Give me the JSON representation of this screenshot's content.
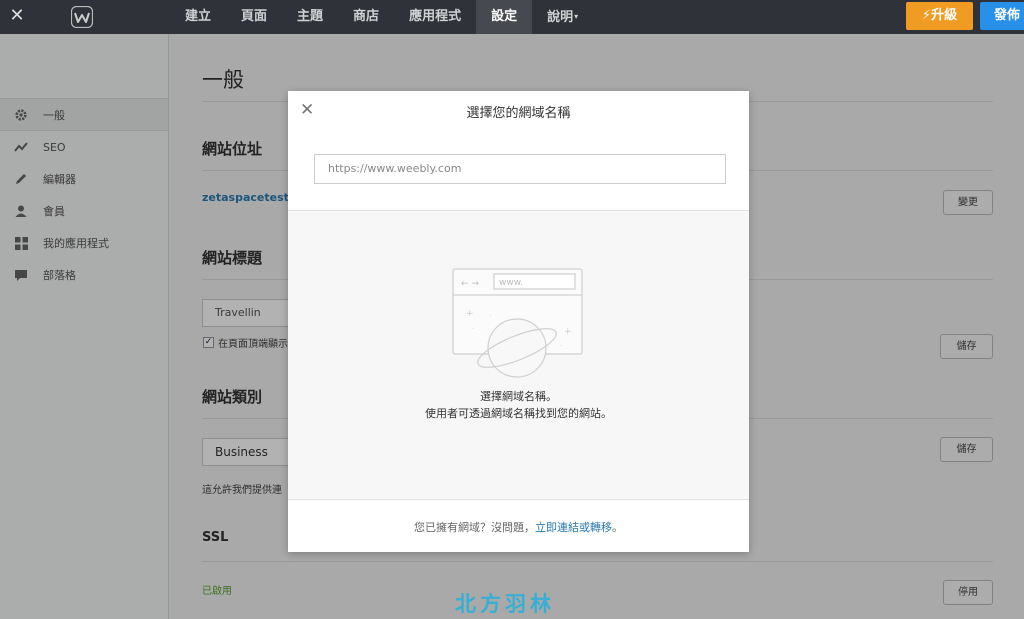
{
  "topbar": {
    "close_icon": "close-icon",
    "logo_icon": "weebly-logo-icon",
    "nav": [
      {
        "label": "建立",
        "active": false
      },
      {
        "label": "頁面",
        "active": false
      },
      {
        "label": "主題",
        "active": false
      },
      {
        "label": "商店",
        "active": false
      },
      {
        "label": "應用程式",
        "active": false
      },
      {
        "label": "設定",
        "active": true
      },
      {
        "label": "說明",
        "active": false
      }
    ],
    "upgrade_label": "升級",
    "publish_label": "發佈",
    "colors": {
      "bar": "#2f3238",
      "upgrade": "#f09b22",
      "publish": "#2990ea"
    }
  },
  "sidebar": {
    "items": [
      {
        "label": "一般",
        "icon": "gear-icon",
        "active": true
      },
      {
        "label": "SEO",
        "icon": "trend-line-icon",
        "active": false
      },
      {
        "label": "編輯器",
        "icon": "pencil-icon",
        "active": false
      },
      {
        "label": "會員",
        "icon": "user-icon",
        "active": false
      },
      {
        "label": "我的應用程式",
        "icon": "apps-grid-icon",
        "active": false
      },
      {
        "label": "部落格",
        "icon": "comment-icon",
        "active": false
      }
    ]
  },
  "main": {
    "title": "一般",
    "site_address": {
      "heading": "網站位址",
      "url": "zetaspacetest.w",
      "button": "變更"
    },
    "site_title": {
      "heading": "網站標題",
      "value": "Travellin",
      "checkbox_label": "在頁面頂端顯示",
      "checked": true,
      "button": "儲存"
    },
    "site_category": {
      "heading": "網站類別",
      "value": "Business",
      "help": "這允許我們提供連",
      "button": "儲存"
    },
    "ssl": {
      "heading": "SSL",
      "status": "已啟用",
      "button": "停用"
    }
  },
  "modal": {
    "title": "選擇您的網域名稱",
    "input_placeholder": "https://www.weebly.com",
    "illustration_text": "www.",
    "line1": "選擇網域名稱。",
    "line2": "使用者可透過網域名稱找到您的網站。",
    "footer_text": "您已擁有網域？沒問題，",
    "footer_link": "立即連結或轉移",
    "footer_end": "。"
  },
  "watermark": "北方羽林"
}
